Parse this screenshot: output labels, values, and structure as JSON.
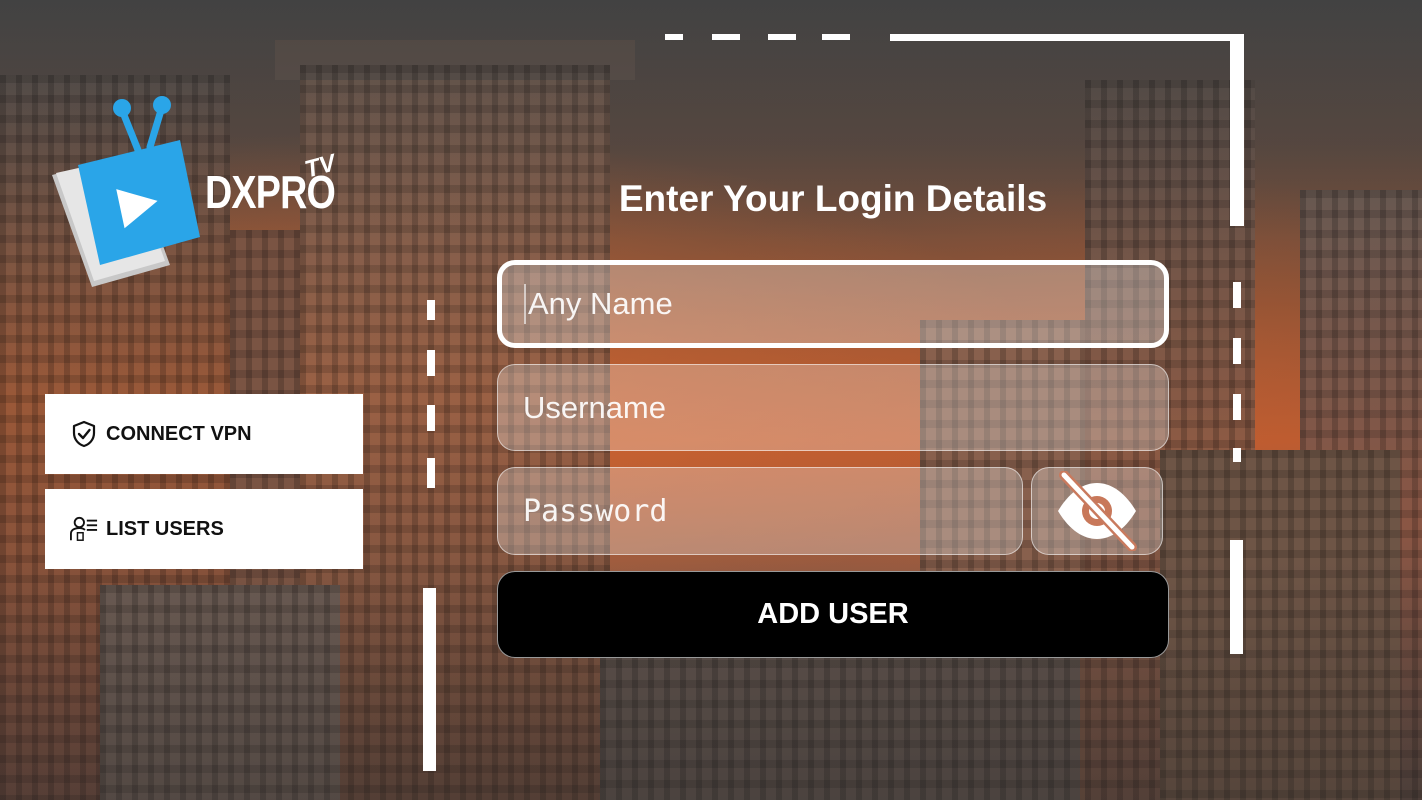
{
  "app": {
    "logo_text": "DXPRO",
    "logo_sub": "TV"
  },
  "sidebar": {
    "connect_vpn": {
      "label": "CONNECT VPN",
      "icon": "shield-check-icon"
    },
    "list_users": {
      "label": "LIST USERS",
      "icon": "users-list-icon"
    }
  },
  "form": {
    "title": "Enter Your Login Details",
    "name": {
      "placeholder": "Any Name",
      "value": ""
    },
    "username": {
      "placeholder": "Username",
      "value": ""
    },
    "password": {
      "placeholder": "Password",
      "value": ""
    },
    "toggle_icon": "eye-off-icon",
    "submit_label": "ADD USER"
  },
  "colors": {
    "accent": "#d4622c",
    "button_bg": "#000000",
    "panel_bg": "#ffffff"
  }
}
